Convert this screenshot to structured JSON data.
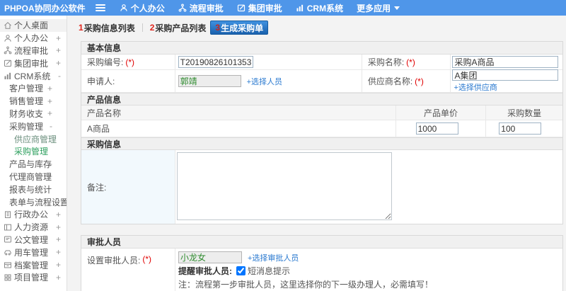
{
  "colors": {
    "topbar_blue": "#4f96e9",
    "active_tab_blue": "#1a61ad",
    "link_blue": "#2b7ad0",
    "required_red": "#e00000",
    "readonly_green": "#2e8b2e",
    "active_menu_green": "#2fa05f"
  },
  "topbar": {
    "logo": "PHPOA协同办公软件",
    "nav": [
      {
        "label": "个人办公",
        "icon": "user-icon"
      },
      {
        "label": "流程审批",
        "icon": "flow-icon"
      },
      {
        "label": "集团审批",
        "icon": "edit-icon"
      },
      {
        "label": "CRM系统",
        "icon": "chart-icon"
      },
      {
        "label": "更多应用",
        "icon": "caret-down-icon"
      }
    ]
  },
  "sidebar": {
    "items": [
      {
        "label": "个人桌面"
      },
      {
        "label": "个人办公",
        "toggle": "+"
      },
      {
        "label": "流程审批",
        "toggle": "+"
      },
      {
        "label": "集团审批",
        "toggle": "+"
      },
      {
        "label": "CRM系统",
        "toggle": "-"
      },
      {
        "label": "客户管理",
        "toggle": "+"
      },
      {
        "label": "销售管理",
        "toggle": "+"
      },
      {
        "label": "财务收支",
        "toggle": "+"
      },
      {
        "label": "采购管理",
        "toggle": "-"
      },
      {
        "label": "供应商管理"
      },
      {
        "label": "采购管理"
      },
      {
        "label": "产品与库存",
        "toggle": "+"
      },
      {
        "label": "代理商管理",
        "toggle": "+"
      },
      {
        "label": "报表与统计"
      },
      {
        "label": "表单与流程设置",
        "toggle": "+"
      },
      {
        "label": "行政办公",
        "toggle": "+"
      },
      {
        "label": "人力资源",
        "toggle": "+"
      },
      {
        "label": "公文管理",
        "toggle": "+"
      },
      {
        "label": "用车管理",
        "toggle": "+"
      },
      {
        "label": "档案管理",
        "toggle": "+"
      },
      {
        "label": "项目管理",
        "toggle": "+"
      }
    ]
  },
  "tabs": [
    {
      "num": "1",
      "label": "采购信息列表"
    },
    {
      "num": "2",
      "label": "采购产品列表"
    },
    {
      "num": "3",
      "label": "生成采购单"
    }
  ],
  "form": {
    "basic": {
      "title": "基本信息",
      "purchase_no_label": "采购编号:",
      "purchase_no_req": "(*)",
      "purchase_no_value": "T20190826101353",
      "purchase_name_label": "采购名称:",
      "purchase_name_req": "(*)",
      "purchase_name_value": "采购A商品",
      "applicant_label": "申请人:",
      "applicant_value": "郭靖",
      "applicant_link": "+选择人员",
      "supplier_label": "供应商名称:",
      "supplier_req": "(*)",
      "supplier_value": "A集团",
      "supplier_link": "+选择供应商"
    },
    "product": {
      "title": "产品信息",
      "col_name": "产品名称",
      "col_price": "产品单价",
      "col_qty": "采购数量",
      "rows": [
        {
          "name": "A商品",
          "price": "1000",
          "qty": "100"
        }
      ]
    },
    "purchase": {
      "title": "采购信息",
      "remark_label": "备注:",
      "remark_value": ""
    },
    "approver": {
      "title": "审批人员",
      "set_label": "设置审批人员:",
      "set_req": "(*)",
      "approver_value": "小龙女",
      "approver_link": "+选择审批人员",
      "remind_label": "提醒审批人员:",
      "sms_label": "短消息提示",
      "sms_checked": "checked",
      "note": "注：流程第一步审批人员，这里选择你的下一级办理人，必需填写！"
    }
  }
}
